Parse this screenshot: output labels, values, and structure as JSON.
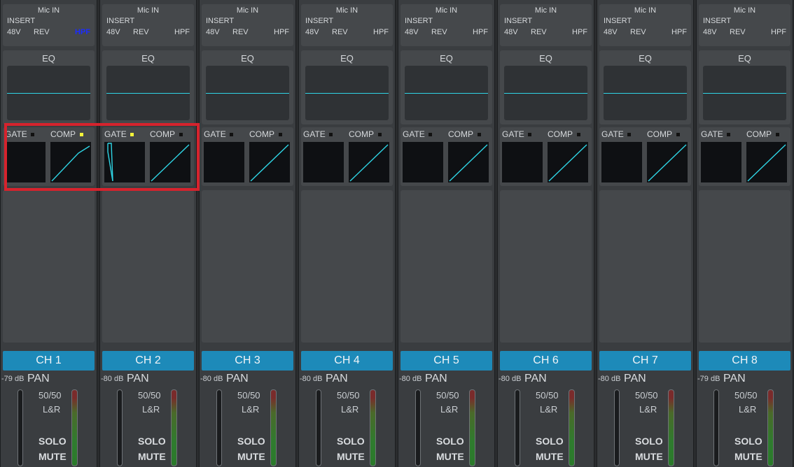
{
  "channels": [
    {
      "mic_in": "Mic IN",
      "insert": "INSERT",
      "opt_48v": "48V",
      "opt_rev": "REV",
      "opt_hpf": "HPF",
      "hpf_on": true,
      "eq_label": "EQ",
      "gate_label": "GATE",
      "comp_label": "COMP",
      "gate_on": false,
      "comp_on": true,
      "gate_curve": "flat",
      "name": "CH 1",
      "level": "-79 dB",
      "pan_label": "PAN",
      "pan_value": "50/50",
      "bus": "L&R",
      "solo": "SOLO",
      "mute": "MUTE"
    },
    {
      "mic_in": "Mic IN",
      "insert": "INSERT",
      "opt_48v": "48V",
      "opt_rev": "REV",
      "opt_hpf": "HPF",
      "hpf_on": false,
      "eq_label": "EQ",
      "gate_label": "GATE",
      "comp_label": "COMP",
      "gate_on": true,
      "comp_on": false,
      "gate_curve": "active",
      "name": "CH 2",
      "level": "-80 dB",
      "pan_label": "PAN",
      "pan_value": "50/50",
      "bus": "L&R",
      "solo": "SOLO",
      "mute": "MUTE"
    },
    {
      "mic_in": "Mic IN",
      "insert": "INSERT",
      "opt_48v": "48V",
      "opt_rev": "REV",
      "opt_hpf": "HPF",
      "hpf_on": false,
      "eq_label": "EQ",
      "gate_label": "GATE",
      "comp_label": "COMP",
      "gate_on": false,
      "comp_on": false,
      "gate_curve": "flat",
      "name": "CH 3",
      "level": "-80 dB",
      "pan_label": "PAN",
      "pan_value": "50/50",
      "bus": "L&R",
      "solo": "SOLO",
      "mute": "MUTE"
    },
    {
      "mic_in": "Mic IN",
      "insert": "INSERT",
      "opt_48v": "48V",
      "opt_rev": "REV",
      "opt_hpf": "HPF",
      "hpf_on": false,
      "eq_label": "EQ",
      "gate_label": "GATE",
      "comp_label": "COMP",
      "gate_on": false,
      "comp_on": false,
      "gate_curve": "flat",
      "name": "CH 4",
      "level": "-80 dB",
      "pan_label": "PAN",
      "pan_value": "50/50",
      "bus": "L&R",
      "solo": "SOLO",
      "mute": "MUTE"
    },
    {
      "mic_in": "Mic IN",
      "insert": "INSERT",
      "opt_48v": "48V",
      "opt_rev": "REV",
      "opt_hpf": "HPF",
      "hpf_on": false,
      "eq_label": "EQ",
      "gate_label": "GATE",
      "comp_label": "COMP",
      "gate_on": false,
      "comp_on": false,
      "gate_curve": "flat",
      "name": "CH 5",
      "level": "-80 dB",
      "pan_label": "PAN",
      "pan_value": "50/50",
      "bus": "L&R",
      "solo": "SOLO",
      "mute": "MUTE"
    },
    {
      "mic_in": "Mic IN",
      "insert": "INSERT",
      "opt_48v": "48V",
      "opt_rev": "REV",
      "opt_hpf": "HPF",
      "hpf_on": false,
      "eq_label": "EQ",
      "gate_label": "GATE",
      "comp_label": "COMP",
      "gate_on": false,
      "comp_on": false,
      "gate_curve": "flat",
      "name": "CH 6",
      "level": "-80 dB",
      "pan_label": "PAN",
      "pan_value": "50/50",
      "bus": "L&R",
      "solo": "SOLO",
      "mute": "MUTE"
    },
    {
      "mic_in": "Mic IN",
      "insert": "INSERT",
      "opt_48v": "48V",
      "opt_rev": "REV",
      "opt_hpf": "HPF",
      "hpf_on": false,
      "eq_label": "EQ",
      "gate_label": "GATE",
      "comp_label": "COMP",
      "gate_on": false,
      "comp_on": false,
      "gate_curve": "flat",
      "name": "CH 7",
      "level": "-80 dB",
      "pan_label": "PAN",
      "pan_value": "50/50",
      "bus": "L&R",
      "solo": "SOLO",
      "mute": "MUTE"
    },
    {
      "mic_in": "Mic IN",
      "insert": "INSERT",
      "opt_48v": "48V",
      "opt_rev": "REV",
      "opt_hpf": "HPF",
      "hpf_on": false,
      "eq_label": "EQ",
      "gate_label": "GATE",
      "comp_label": "COMP",
      "gate_on": false,
      "comp_on": false,
      "gate_curve": "flat",
      "name": "CH 8",
      "level": "-79 dB",
      "pan_label": "PAN",
      "pan_value": "50/50",
      "bus": "L&R",
      "solo": "SOLO",
      "mute": "MUTE"
    }
  ],
  "colors": {
    "accent_cyan": "#2fd6e6",
    "channel_blue": "#1d8ab9",
    "hpf_active": "#1b2cff",
    "led_on": "#f2f23a",
    "highlight_red": "#d6232d"
  }
}
